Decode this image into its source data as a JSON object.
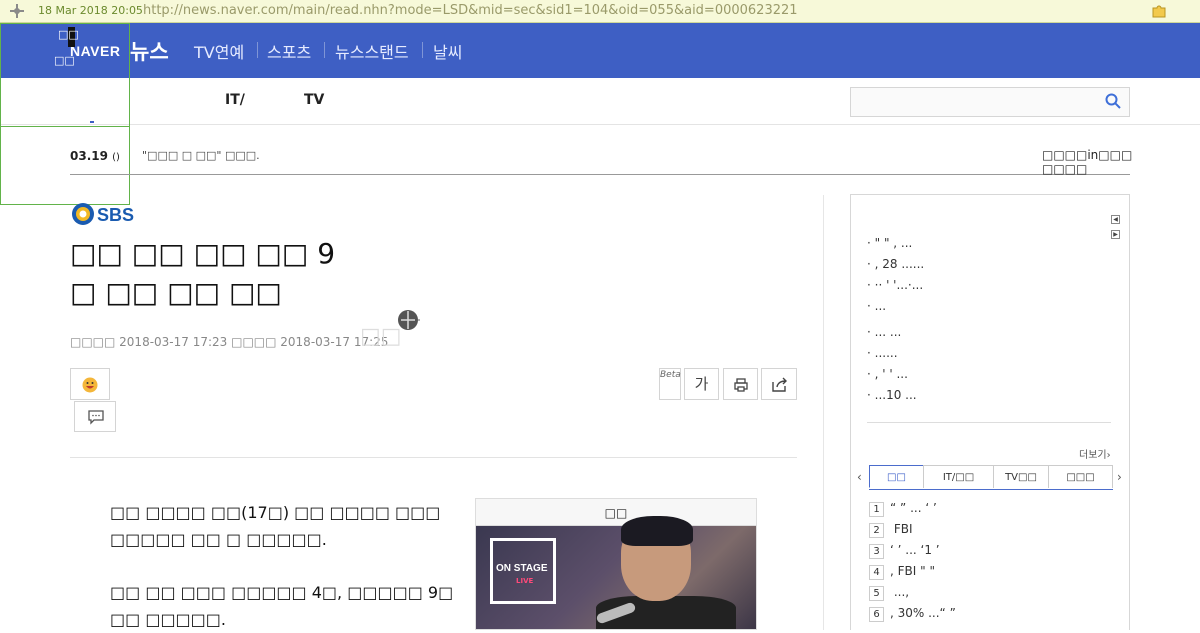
{
  "archive": {
    "date": "18 Mar 2018 20:05",
    "url": "http://news.naver.com/main/read.nhn?mode=LSD&mid=sec&sid1=104&oid=055&aid=0000623221"
  },
  "header": {
    "logo": "NAVER",
    "news_label": "뉴스",
    "nav": [
      "TV연예",
      "스포츠",
      "뉴스스탠드",
      "날씨"
    ]
  },
  "overlay": {
    "line1": "□□",
    "line2": "□□"
  },
  "subnav": {
    "items": [
      "IT/",
      "TV"
    ],
    "search_placeholder": ""
  },
  "ticker": {
    "date": "03.19",
    "suffix": "()",
    "headline": "\"□□□ □ □□\" □□□.",
    "right_text": "□□□□in□□□ □□□□"
  },
  "article": {
    "press": "SBS",
    "title_line1": "□□ □□ □□ □□ 9",
    "title_line2": "□ □□ □□ □□",
    "meta": "□□□□ 2018-03-17 17:23   □□□□ 2018-03-17 17:25",
    "meta_extra": "□□",
    "beta_label": "Beta",
    "font_label": "가",
    "para1": "□□ □□□□ □□(17□) □□ □□□□ □□□ □□□□□ □□ □ □□□□□.",
    "para2": "□□ □□ □□□ □□□□□ 4□, □□□□□ 9□ □□ □□□□□.",
    "video_header": "□□",
    "video_badge": "ON STAGE",
    "video_badge_sub": "LIVE"
  },
  "sidebar": {
    "list": [
      "· \" \" ,   ...",
      "· ,  28    ......",
      "· ·· ' '...·...",
      "·    ...",
      "·  ...    ...",
      "·      ......",
      "· ,  ' ' ...",
      "·    ...10   ..."
    ],
    "more": "더보기›",
    "tabs": [
      "□□",
      "IT/□□",
      "TV□□",
      "□□□"
    ],
    "ranking": [
      {
        "num": "1",
        "text": "“ ”  ...  ‘ ’"
      },
      {
        "num": "2",
        "text": "   FBI"
      },
      {
        "num": "3",
        "text": "‘ ’ ... ‘1 ’"
      },
      {
        "num": "4",
        "text": ",  FBI  \"    \""
      },
      {
        "num": "5",
        "text": "      ...,"
      },
      {
        "num": "6",
        "text": ",  30% ...“  ”"
      }
    ]
  }
}
